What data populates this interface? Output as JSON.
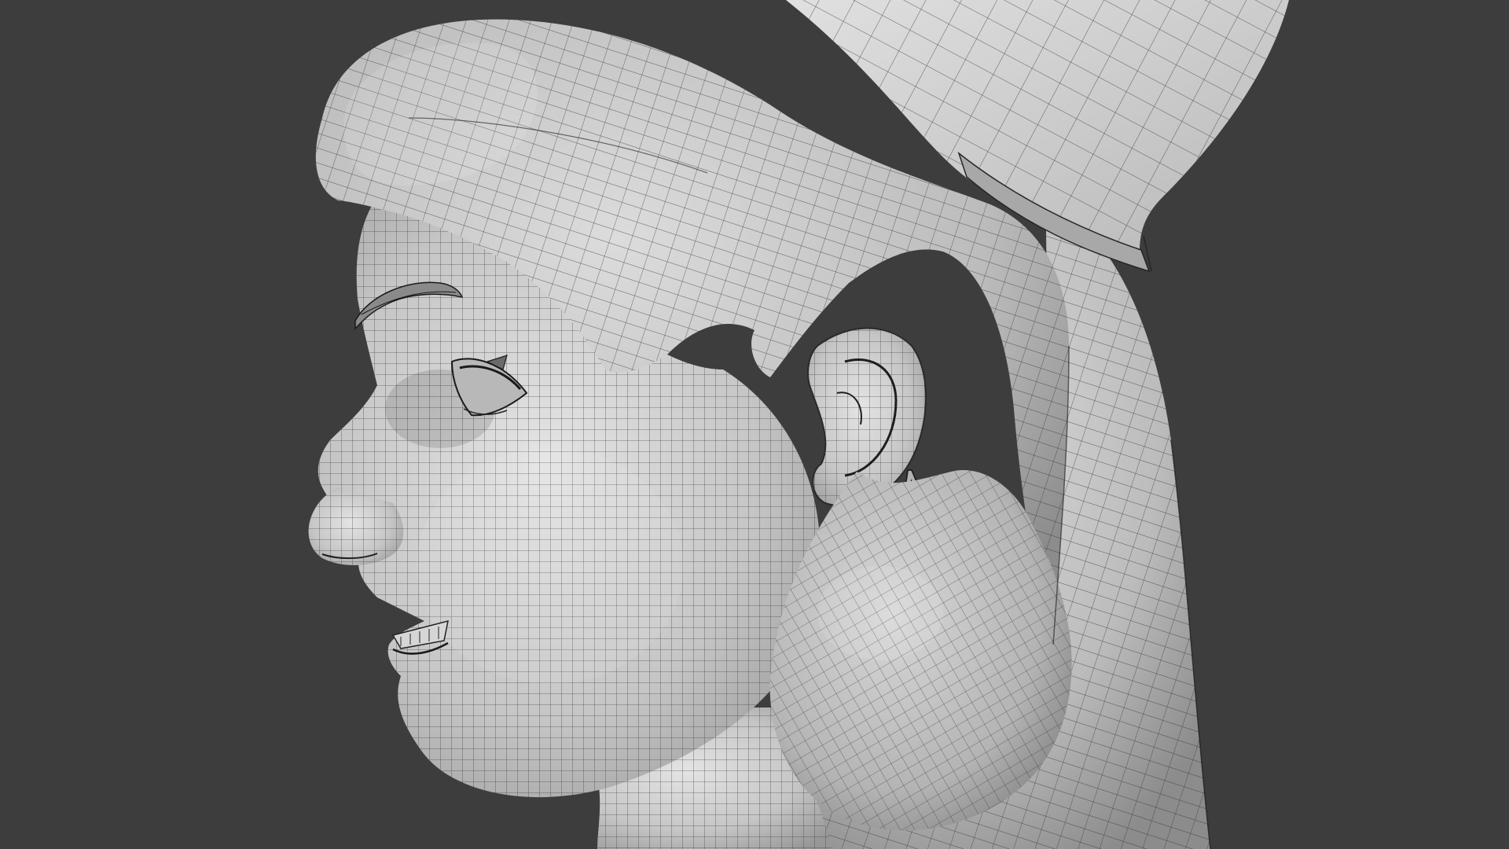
{
  "viewport": {
    "background_color": "#3d3d3d",
    "mesh_fill_color": "#c9c9c9",
    "mesh_highlight_color": "#e2e2e2",
    "mesh_shadow_color": "#8e8e8e",
    "wire_color": "#2a2a2a",
    "shading_mode": "solid-wireframe-overlay",
    "objects": [
      {
        "name": "head-mesh"
      },
      {
        "name": "hair-mesh"
      },
      {
        "name": "hat-mesh"
      },
      {
        "name": "ear-mesh"
      },
      {
        "name": "earring-mesh"
      },
      {
        "name": "eyebrow-mesh"
      },
      {
        "name": "eye-mesh"
      },
      {
        "name": "teeth-mesh"
      }
    ]
  }
}
